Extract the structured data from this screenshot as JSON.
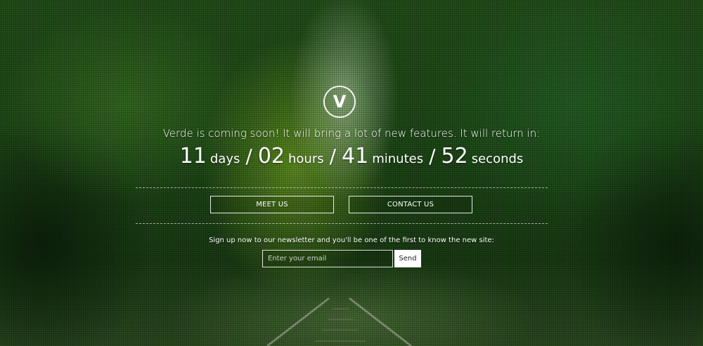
{
  "logo": {
    "letter": "V",
    "icon": "circle-v-logo-icon"
  },
  "tagline": "Verde is coming soon! It will bring a lot of new features. It will return in:",
  "countdown": {
    "days": "11",
    "days_label": "days",
    "hours": "02",
    "hours_label": "hours",
    "minutes": "41",
    "minutes_label": "minutes",
    "seconds": "52",
    "seconds_label": "seconds",
    "separator": "/"
  },
  "buttons": {
    "meet_us": "MEET US",
    "contact_us": "CONTACT US"
  },
  "newsletter": {
    "text": "Sign up now to our newsletter and you'll be one of the first to know the new site:",
    "email_placeholder": "Enter your email",
    "send_label": "Send"
  },
  "colors": {
    "accent": "#ffffff",
    "foliage": "#2c5a1e"
  }
}
